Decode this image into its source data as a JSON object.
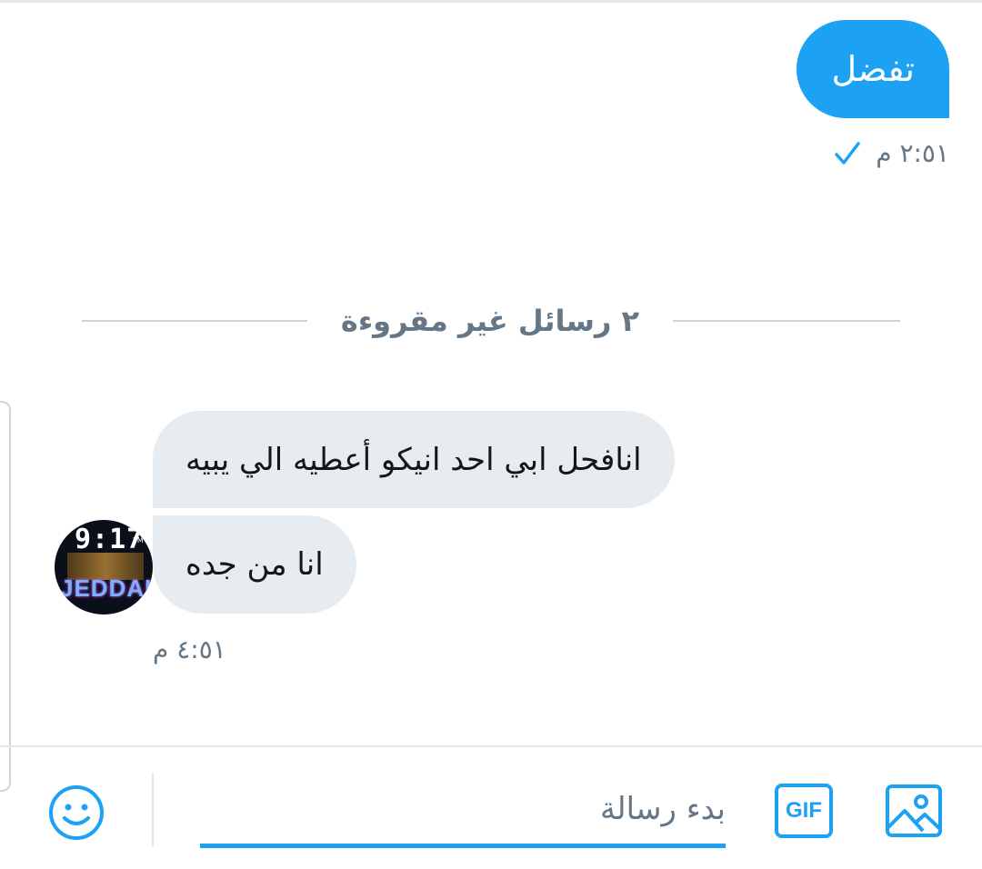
{
  "colors": {
    "accent": "#1da1f2",
    "incoming_bubble": "#e6ecf0",
    "muted_text": "#657786"
  },
  "outgoing": {
    "text": "تفضل",
    "time": "٢:٥١ م",
    "status_icon": "checkmark-icon"
  },
  "unread_divider": {
    "label": "٢ رسائل غير مقروءة"
  },
  "incoming": {
    "avatar": {
      "clock": "9:17",
      "meridiem": "PM",
      "city": "JEDDAH"
    },
    "messages": [
      {
        "text": "انافحل ابي احد انيكو أعطيه الي يبيه"
      },
      {
        "text": "انا من جده"
      }
    ],
    "time": "٤:٥١ م"
  },
  "composer": {
    "placeholder": "بدء رسالة",
    "gif_label": "GIF",
    "icons": [
      "emoji-icon",
      "gif-icon",
      "image-icon"
    ]
  }
}
